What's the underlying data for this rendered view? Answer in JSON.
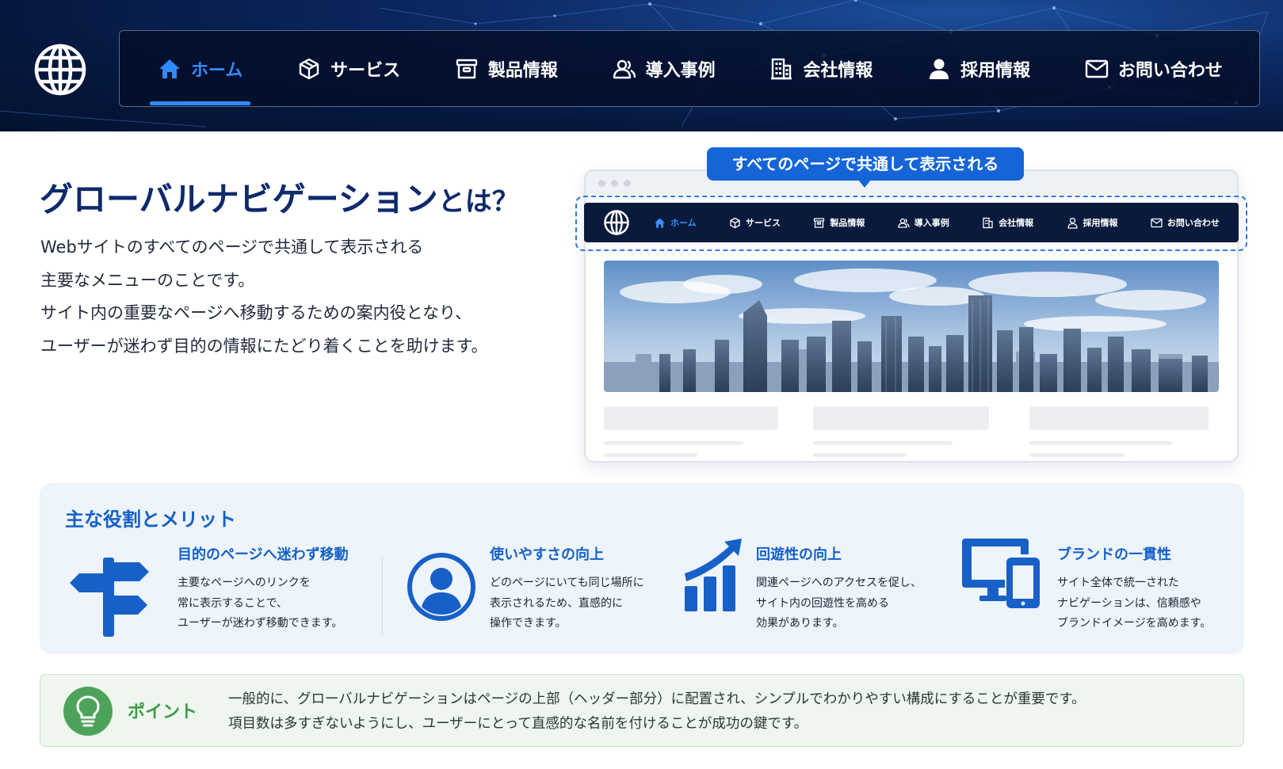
{
  "header": {
    "logo_icon": "globe-icon",
    "nav": [
      {
        "label": "ホーム",
        "icon": "home-icon",
        "active": true
      },
      {
        "label": "サービス",
        "icon": "cube-icon",
        "active": false
      },
      {
        "label": "製品情報",
        "icon": "product-box-icon",
        "active": false
      },
      {
        "label": "導入事例",
        "icon": "users-icon",
        "active": false
      },
      {
        "label": "会社情報",
        "icon": "building-icon",
        "active": false
      },
      {
        "label": "採用情報",
        "icon": "person-icon",
        "active": false
      },
      {
        "label": "お問い合わせ",
        "icon": "mail-icon",
        "active": false
      }
    ]
  },
  "intro": {
    "title_main": "グローバルナビゲーション",
    "title_suffix": "とは？",
    "lines": [
      "Webサイトのすべてのページで共通して表示される",
      "主要なメニューのことです。",
      "サイト内の重要なページへ移動するための案内役となり、",
      "ユーザーが迷わず目的の情報にたどり着くことを助けます。"
    ]
  },
  "mockup": {
    "callout": "すべてのページで共通して表示される"
  },
  "roles": {
    "title": "主な役割とメリット",
    "items": [
      {
        "icon": "signpost-icon",
        "title": "目的のページへ迷わず移動",
        "lines": [
          "主要なページへのリンクを",
          "常に表示することで、",
          "ユーザーが迷わず移動できます。"
        ]
      },
      {
        "icon": "user-circle-icon",
        "title": "使いやすさの向上",
        "lines": [
          "どのページにいても同じ場所に",
          "表示されるため、直感的に",
          "操作できます。"
        ]
      },
      {
        "icon": "growth-chart-icon",
        "title": "回遊性の向上",
        "lines": [
          "関連ページへのアクセスを促し、",
          "サイト内の回遊性を高める",
          "効果があります。"
        ]
      },
      {
        "icon": "devices-icon",
        "title": "ブランドの一貫性",
        "lines": [
          "サイト全体で統一された",
          "ナビゲーションは、信頼感や",
          "ブランドイメージを高めます。"
        ]
      }
    ]
  },
  "point": {
    "icon": "lightbulb-icon",
    "label": "ポイント",
    "lines": [
      "一般的に、グローバルナビゲーションはページの上部（ヘッダー部分）に配置され、シンプルでわかりやすい構成にすることが重要です。",
      "項目数は多すぎないようにし、ユーザーにとって直感的な名前を付けることが成功の鍵です。"
    ]
  },
  "colors": {
    "accent": "#2f8bff",
    "heading": "#0d2a6b",
    "role_title": "#1460c8",
    "callout": "#1565d8",
    "point_green": "#3f9a4c",
    "header_dark": "#06183f"
  }
}
